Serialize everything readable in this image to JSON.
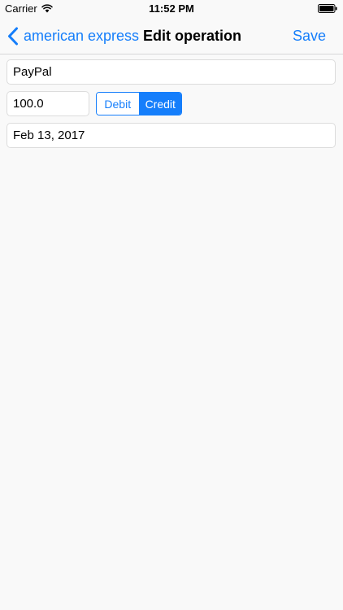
{
  "status_bar": {
    "carrier": "Carrier",
    "time": "11:52 PM"
  },
  "nav_bar": {
    "back_label": "american express",
    "title": "Edit operation",
    "save_label": "Save"
  },
  "form": {
    "name_value": "PayPal",
    "amount_value": "100.0",
    "type_options": [
      "Debit",
      "Credit"
    ],
    "type_selected": "Credit",
    "date_value": "Feb 13, 2017"
  },
  "colors": {
    "accent": "#157efb",
    "background": "#f9f9f9",
    "field_border": "#dcdcdc"
  },
  "icons": {
    "wifi": "wifi-icon",
    "battery": "battery-icon",
    "back": "chevron-left-icon"
  }
}
